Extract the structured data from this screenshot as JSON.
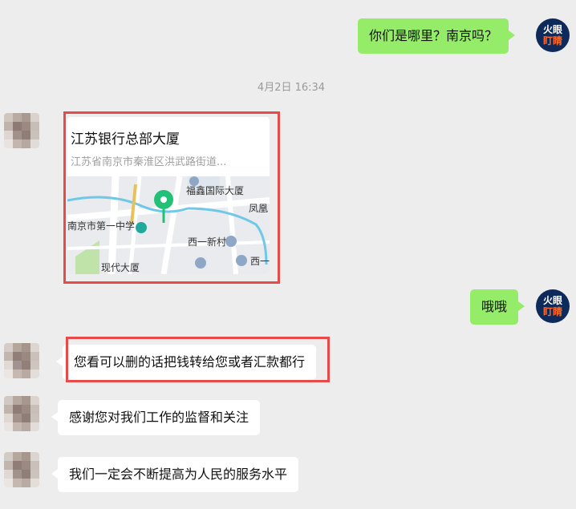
{
  "chat": {
    "timestamp": "4月2日 16:34",
    "messages": {
      "m1": "你们是哪里？南京吗？",
      "m2": "哦哦",
      "m3": "您看可以删的话把钱转给您或者汇款都行",
      "m4": "感谢您对我们工作的监督和关注",
      "m5": "我们一定会不断提高为人民的服务水平"
    },
    "location": {
      "title": "江苏银行总部大厦",
      "address": "江苏省南京市秦淮区洪武路街道...",
      "map_labels": {
        "fuxin": "福鑫国际大厦",
        "school": "南京市第一中学",
        "fengshan": "凤凰",
        "xiyi_xincun": "西一新村",
        "xiyi": "西一",
        "xiandai": "现代大厦"
      }
    }
  },
  "avatar_logo": {
    "line1": "火眼",
    "line2": "盯睛"
  },
  "colors": {
    "chat_bg": "#ededed",
    "green_bubble": "#95ec69",
    "white_bubble": "#ffffff",
    "highlight": "#e84a4a",
    "map_pin": "#1fbf6e",
    "logo_bg": "#0e2a5a"
  }
}
